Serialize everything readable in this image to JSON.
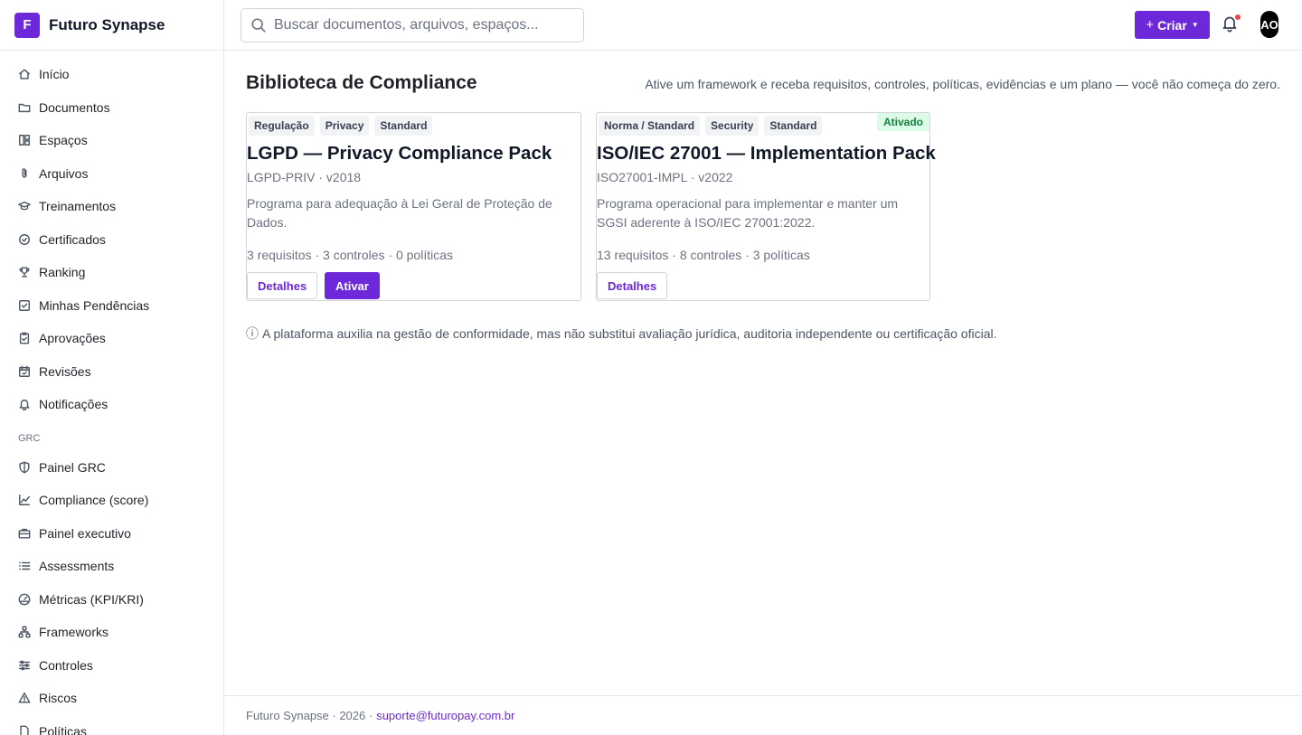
{
  "brand": {
    "logo_letter": "F",
    "name": "Futuro Synapse"
  },
  "sidebar": {
    "items": [
      {
        "label": "Início",
        "icon": "home-icon"
      },
      {
        "label": "Documentos",
        "icon": "folder-icon"
      },
      {
        "label": "Espaços",
        "icon": "grid-icon"
      },
      {
        "label": "Arquivos",
        "icon": "paperclip-icon"
      },
      {
        "label": "Treinamentos",
        "icon": "graduation-cap-icon"
      },
      {
        "label": "Certificados",
        "icon": "check-circle-icon"
      },
      {
        "label": "Ranking",
        "icon": "trophy-icon"
      },
      {
        "label": "Minhas Pendências",
        "icon": "check-square-icon"
      },
      {
        "label": "Aprovações",
        "icon": "clipboard-check-icon"
      },
      {
        "label": "Revisões",
        "icon": "calendar-check-icon"
      },
      {
        "label": "Notificações",
        "icon": "bell-icon"
      }
    ],
    "section_grc": "GRC",
    "grc_items": [
      {
        "label": "Painel GRC",
        "icon": "shield-icon"
      },
      {
        "label": "Compliance (score)",
        "icon": "line-chart-icon"
      },
      {
        "label": "Painel executivo",
        "icon": "briefcase-icon"
      },
      {
        "label": "Assessments",
        "icon": "list-icon"
      },
      {
        "label": "Métricas (KPI/KRI)",
        "icon": "gauge-icon"
      },
      {
        "label": "Frameworks",
        "icon": "network-icon"
      },
      {
        "label": "Controles",
        "icon": "sliders-icon"
      },
      {
        "label": "Riscos",
        "icon": "alert-triangle-icon"
      },
      {
        "label": "Políticas",
        "icon": "file-icon"
      }
    ]
  },
  "header": {
    "search_placeholder": "Buscar documentos, arquivos, espaços...",
    "create_label": "Criar",
    "avatar_initials": "AO"
  },
  "main": {
    "title": "Biblioteca de Compliance",
    "subtitle": "Ative um framework e receba requisitos, controles, políticas, evidências e um plano — você não começa do zero.",
    "cards": [
      {
        "tags": [
          "Regulação",
          "Privacy",
          "Standard"
        ],
        "title": "LGPD — Privacy Compliance Pack",
        "code": "LGPD-PRIV · v2018",
        "description": "Programa para adequação à Lei Geral de Proteção de Dados.",
        "stats": "3 requisitos · 3 controles · 0 políticas",
        "details_label": "Detalhes",
        "activate_label": "Ativar"
      },
      {
        "tags": [
          "Norma / Standard",
          "Security",
          "Standard"
        ],
        "badge": "Ativado",
        "title": "ISO/IEC 27001 — Implementation Pack",
        "code": "ISO27001-IMPL · v2022",
        "description": "Programa operacional para implementar e manter um SGSI aderente à ISO/IEC 27001:2022.",
        "stats": "13 requisitos · 8 controles · 3 políticas",
        "details_label": "Detalhes"
      }
    ],
    "disclaimer_icon": "ⓘ",
    "disclaimer": "A plataforma auxilia na gestão de conformidade, mas não substitui avaliação jurídica, auditoria independente ou certificação oficial."
  },
  "footer": {
    "text": "Futuro Synapse · 2026 ·",
    "email": "suporte@futuropay.com.br"
  },
  "colors": {
    "accent": "#6d28d9",
    "success_bg": "#dcfce7",
    "success_text": "#15803d",
    "notification_dot": "#ef4444"
  }
}
